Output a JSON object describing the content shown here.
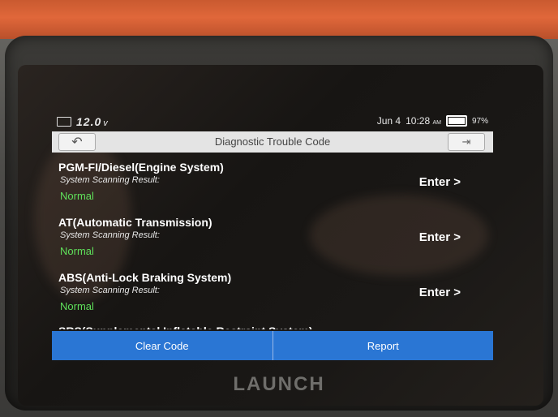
{
  "statusbar": {
    "voltage": "12.0",
    "voltage_unit": "v",
    "date": "Jun 4",
    "time": "10:28",
    "ampm": "AM",
    "battery": "97%"
  },
  "header": {
    "back_icon": "back-arrow-icon",
    "title": "Diagnostic Trouble Code",
    "exit_icon": "exit-icon"
  },
  "systems": [
    {
      "name": "PGM-FI/Diesel(Engine System)",
      "subtitle": "System Scanning Result:",
      "status": "Normal",
      "action": "Enter >"
    },
    {
      "name": "AT(Automatic Transmission)",
      "subtitle": "System Scanning Result:",
      "status": "Normal",
      "action": "Enter >"
    },
    {
      "name": "ABS(Anti-Lock Braking System)",
      "subtitle": "System Scanning Result:",
      "status": "Normal",
      "action": "Enter >"
    }
  ],
  "partial_item": "SRS(Supplemental Inflatable Restraint System)",
  "actions": {
    "clear_code": "Clear Code",
    "report": "Report"
  },
  "device": {
    "brand": "LAUNCH"
  },
  "colors": {
    "status_normal": "#5fe05a",
    "button_blue": "#2a76d4",
    "case_orange": "#e0673a"
  }
}
